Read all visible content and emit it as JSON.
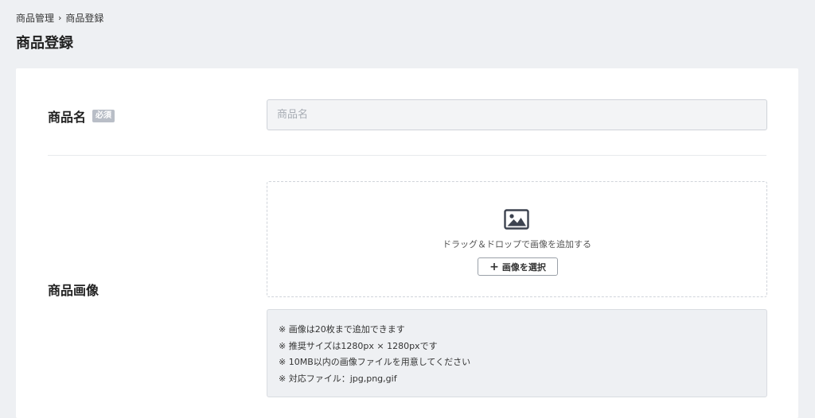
{
  "breadcrumb": {
    "parent": "商品管理",
    "separator": "›",
    "current": "商品登録"
  },
  "page": {
    "title": "商品登録"
  },
  "form": {
    "name_field": {
      "label": "商品名",
      "required_badge": "必須",
      "value": "",
      "placeholder": "商品名"
    },
    "image_field": {
      "label": "商品画像",
      "dropzone_icon": "image-icon",
      "dropzone_text": "ドラッグ＆ドロップで画像を追加する",
      "select_button_icon": "plus-icon",
      "select_button_plus": "+",
      "select_button_label": "画像を選択",
      "notes": [
        "※ 画像は20枚まで追加できます",
        "※ 推奨サイズは1280px × 1280pxです",
        "※ 10MB以内の画像ファイルを用意してください",
        "※ 対応ファイル：jpg,png,gif"
      ]
    }
  },
  "colors": {
    "page_bg": "#eef0f3",
    "card_bg": "#ffffff",
    "badge_bg": "#b9bec7",
    "icon": "#3d4350"
  }
}
